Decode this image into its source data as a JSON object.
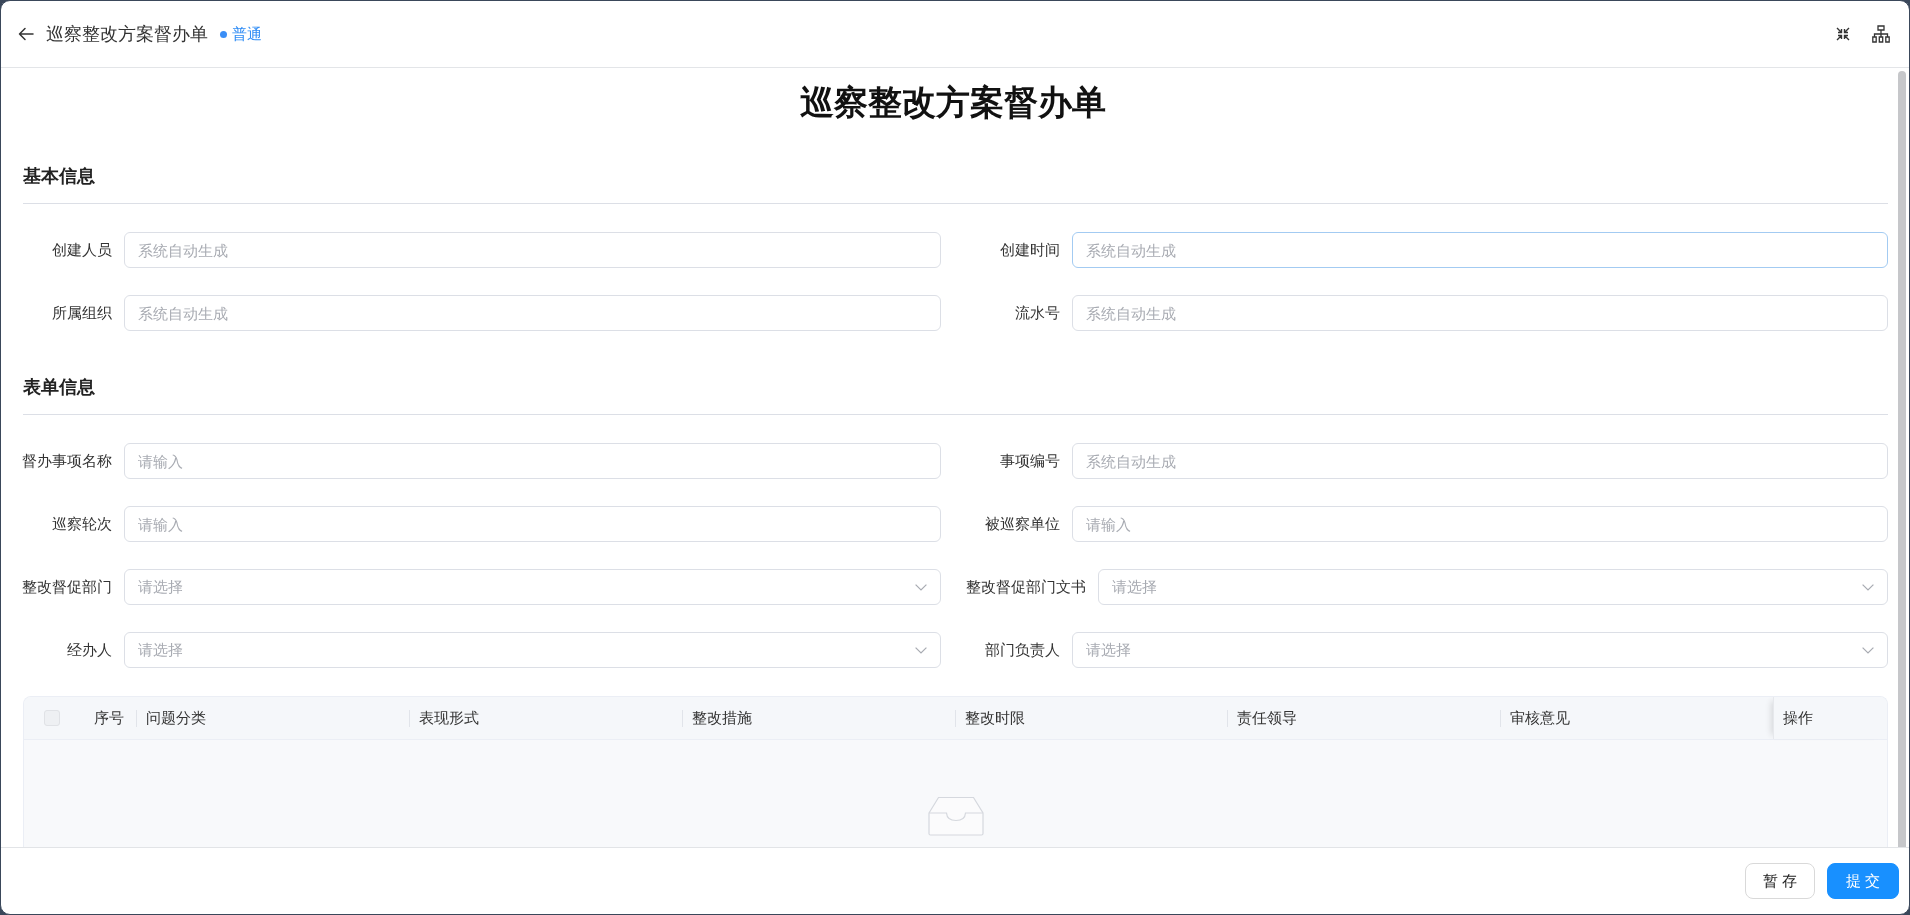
{
  "header": {
    "title": "巡察整改方案督办单",
    "priority": "普通"
  },
  "form_title": "巡察整改方案督办单",
  "sections": [
    {
      "title": "基本信息",
      "fields": [
        {
          "label": "创建人员",
          "kind": "input",
          "placeholder": "系统自动生成",
          "focused": false
        },
        {
          "label": "创建时间",
          "kind": "input",
          "placeholder": "系统自动生成",
          "focused": true
        },
        {
          "label": "所属组织",
          "kind": "input",
          "placeholder": "系统自动生成",
          "focused": false
        },
        {
          "label": "流水号",
          "kind": "input",
          "placeholder": "系统自动生成",
          "focused": false
        }
      ]
    },
    {
      "title": "表单信息",
      "fields": [
        {
          "label": "督办事项名称",
          "kind": "input",
          "placeholder": "请输入",
          "focused": false
        },
        {
          "label": "事项编号",
          "kind": "input",
          "placeholder": "系统自动生成",
          "focused": false
        },
        {
          "label": "巡察轮次",
          "kind": "input",
          "placeholder": "请输入",
          "focused": false
        },
        {
          "label": "被巡察单位",
          "kind": "input",
          "placeholder": "请输入",
          "focused": false
        },
        {
          "label": "整改督促部门",
          "kind": "select",
          "placeholder": "请选择",
          "focused": false
        },
        {
          "label": "整改督促部门文书",
          "kind": "select",
          "placeholder": "请选择",
          "focused": false
        },
        {
          "label": "经办人",
          "kind": "select",
          "placeholder": "请选择",
          "focused": false
        },
        {
          "label": "部门负责人",
          "kind": "select",
          "placeholder": "请选择",
          "focused": false
        }
      ]
    }
  ],
  "table": {
    "header_checkbox": {
      "checked": false,
      "disabled": true
    },
    "columns": [
      "序号",
      "问题分类",
      "表现形式",
      "整改措施",
      "整改时限",
      "责任领导",
      "审核意见",
      "操作"
    ]
  },
  "footer": {
    "buttons": [
      {
        "label": "暂 存",
        "kind": "default"
      },
      {
        "label": "提 交",
        "kind": "primary"
      }
    ]
  }
}
